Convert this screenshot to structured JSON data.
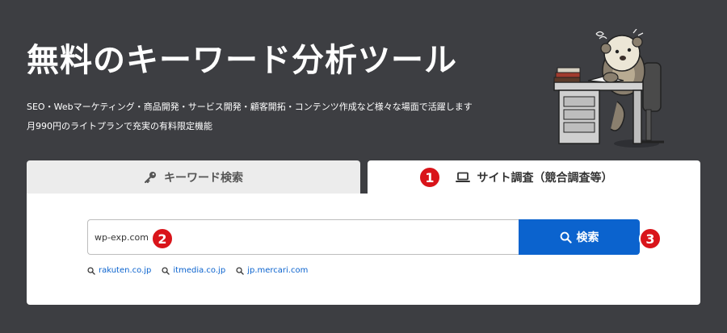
{
  "hero": {
    "title": "無料のキーワード分析ツール",
    "description_line1": "SEO・Webマーケティング・商品開発・サービス開発・顧客開拓・コンテンツ作成など様々な場面で活躍します",
    "description_line2": "月990円のライトプランで充実の有料限定機能"
  },
  "tabs": [
    {
      "label": "キーワード検索",
      "icon": "key-icon",
      "active": false
    },
    {
      "label": "サイト調査（競合調査等）",
      "icon": "laptop-icon",
      "active": true
    }
  ],
  "search": {
    "value": "wp-exp.com",
    "button_label": "検索",
    "button_icon": "search-icon"
  },
  "suggestions": [
    {
      "label": "rakuten.co.jp",
      "icon": "search-icon"
    },
    {
      "label": "itmedia.co.jp",
      "icon": "search-icon"
    },
    {
      "label": "jp.mercari.com",
      "icon": "search-icon"
    }
  ],
  "annotations": [
    "1",
    "2",
    "3"
  ],
  "colors": {
    "background": "#3d3e42",
    "accent": "#0b63ce",
    "badge": "#d9141a",
    "inactive_tab": "#ececec"
  }
}
